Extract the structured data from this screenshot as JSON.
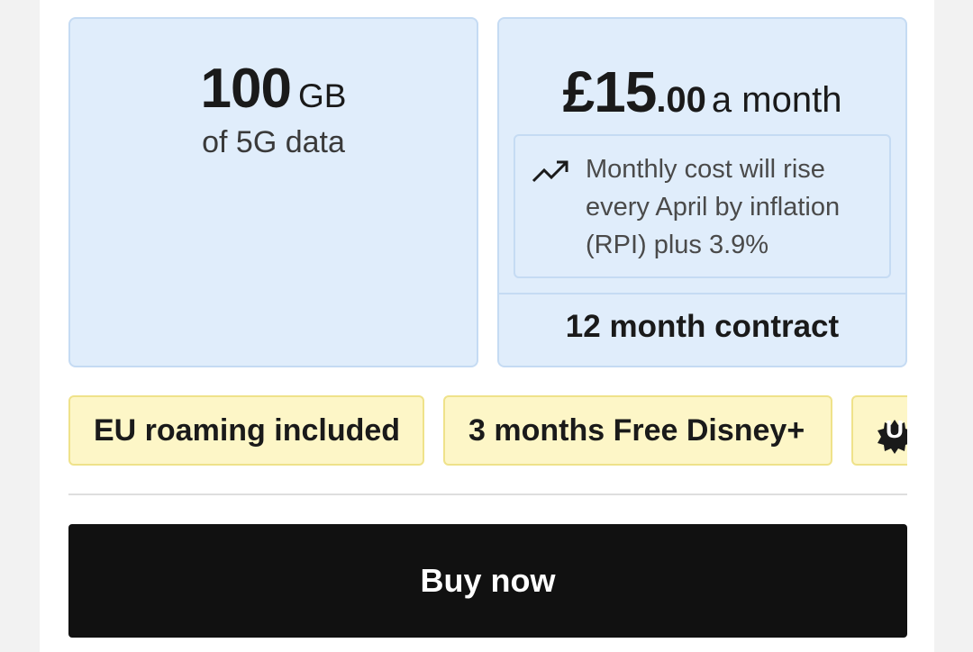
{
  "data_card": {
    "amount": "100",
    "unit": "GB",
    "subtitle": "of 5G data"
  },
  "price_card": {
    "currency_whole": "£15",
    "decimal": ".00",
    "period": "a month",
    "notice_icon": "trending-up-icon",
    "notice_text": "Monthly cost will rise every April by inflation (RPI) plus 3.9%",
    "contract": "12 month contract"
  },
  "perks": {
    "eu_roaming": "EU roaming included",
    "disney": "3 months Free Disney+",
    "third_badge_letter": "U",
    "third_icon": "badge-icon"
  },
  "buy_button": {
    "label": "Buy now"
  },
  "colors": {
    "card_bg": "#e0edfb",
    "card_border": "#c5dbf3",
    "pill_bg": "#fdf6c7",
    "pill_border": "#efe28a",
    "button_bg": "#111111"
  }
}
